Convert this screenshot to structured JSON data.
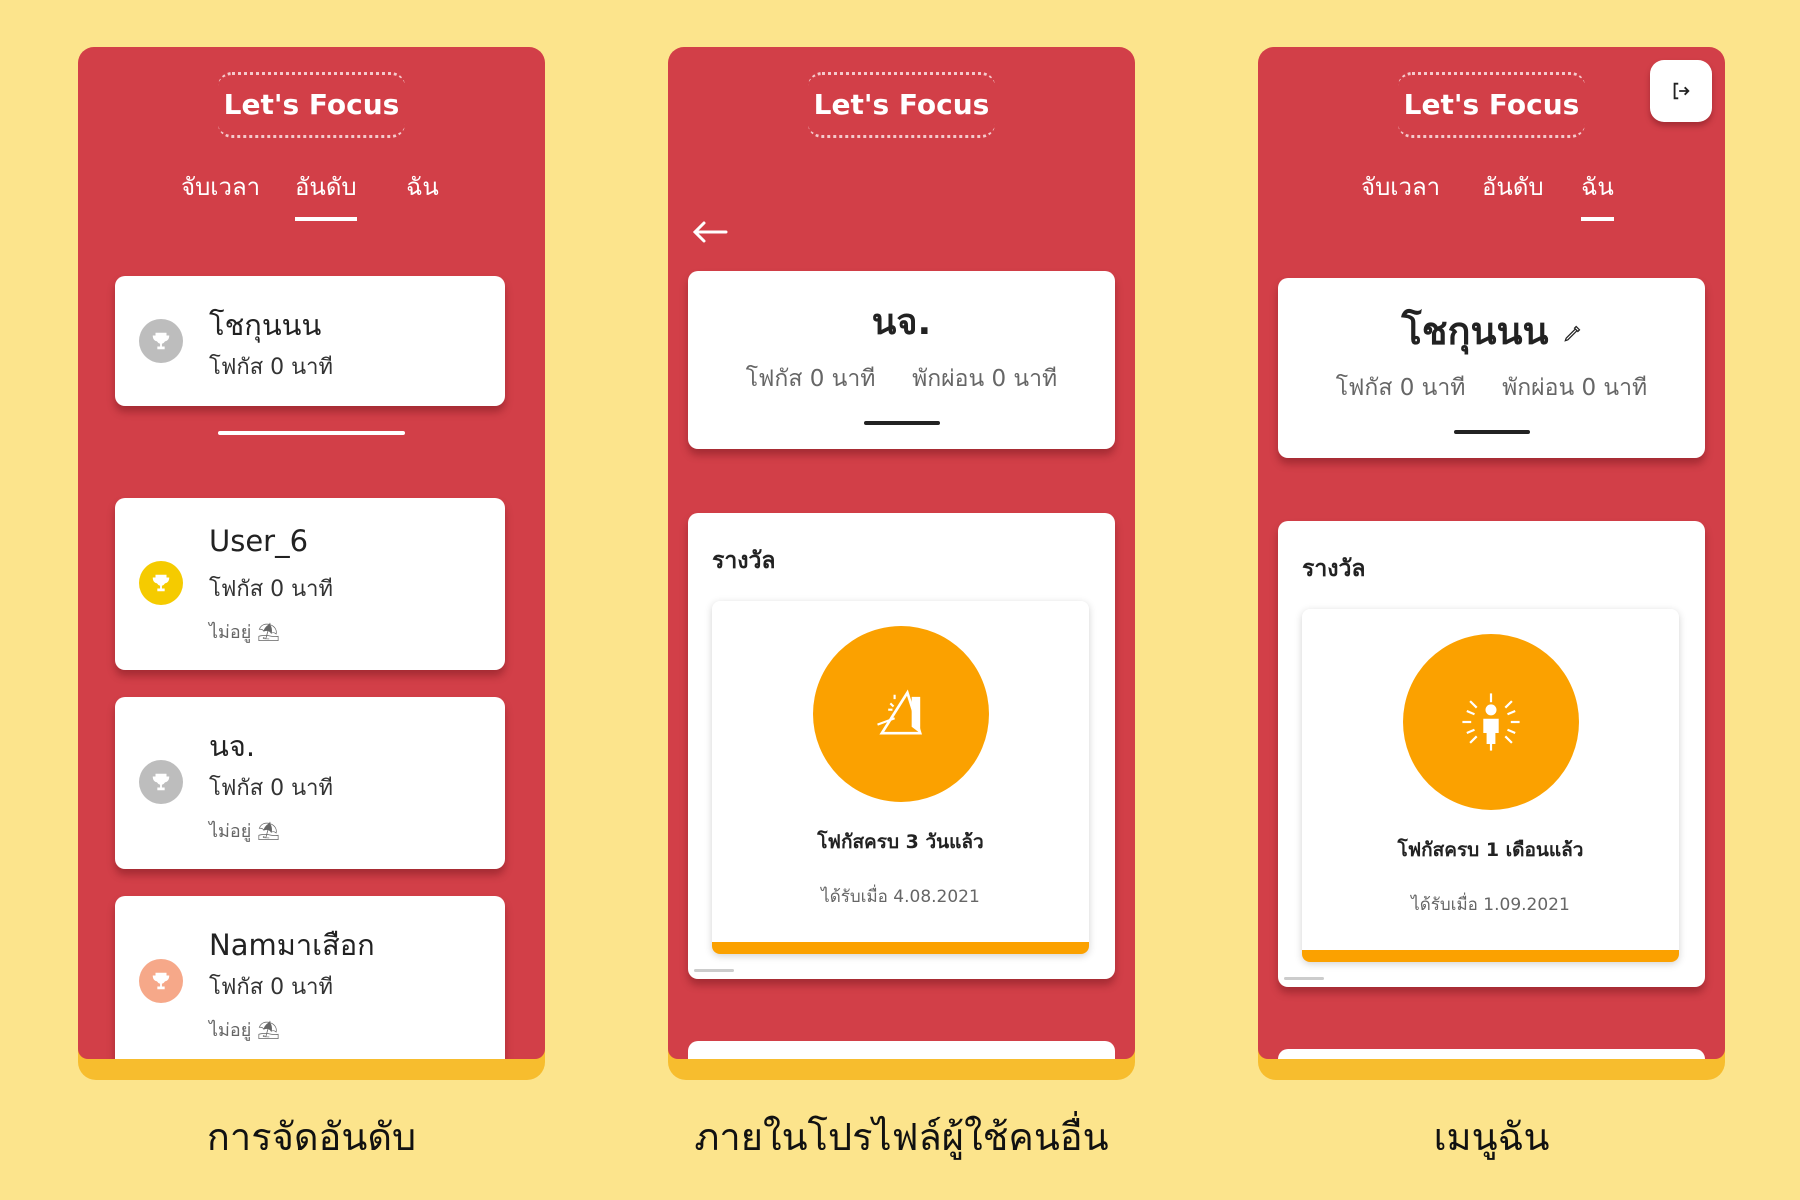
{
  "app_title": "Let's Focus",
  "tabs": [
    "จับเวลา",
    "อันดับ",
    "ฉัน"
  ],
  "screen1": {
    "caption": "การจัดอันดับ",
    "me": {
      "name": "โชกุนนน",
      "focus": "โฟกัส 0 นาที",
      "trophy_color": "#BDBDBD"
    },
    "users": [
      {
        "name": "User_6",
        "focus": "โฟกัส 0 นาที",
        "status": "ไม่อยู่ ⛱",
        "trophy_color": "#F5CB00"
      },
      {
        "name": "นจ.",
        "focus": "โฟกัส 0 นาที",
        "status": "ไม่อยู่ ⛱",
        "trophy_color": "#BDBDBD"
      },
      {
        "name": "Namมาเสือก",
        "focus": "โฟกัส 0 นาที",
        "status": "ไม่อยู่ ⛱",
        "trophy_color": "#F6A889"
      }
    ]
  },
  "screen2": {
    "caption": "ภายในโปรไฟล์ผู้ใช้คนอื่น",
    "profile_name": "นจ.",
    "focus": "โฟกัส 0 นาที",
    "rest": "พักผ่อน 0 นาที",
    "rewards_title": "รางวัล",
    "badge_title": "โฟกัสครบ 3 วันแล้ว",
    "badge_date": "ได้รับเมื่อ 4.08.2021",
    "badge_icon": "prism-icon"
  },
  "screen3": {
    "caption": "เมนูฉัน",
    "profile_name": "โชกุนนน",
    "focus": "โฟกัส 0 นาที",
    "rest": "พักผ่อน 0 นาที",
    "rewards_title": "รางวัล",
    "badge_title": "โฟกัสครบ 1 เดือนแล้ว",
    "badge_date": "ได้รับเมื่อ 1.09.2021",
    "badge_icon": "enlightened-person-icon"
  },
  "colors": {
    "background": "#FCE48C",
    "app_red": "#D23F48",
    "phone_base": "#F7BD2E",
    "badge_orange": "#FBA100"
  }
}
